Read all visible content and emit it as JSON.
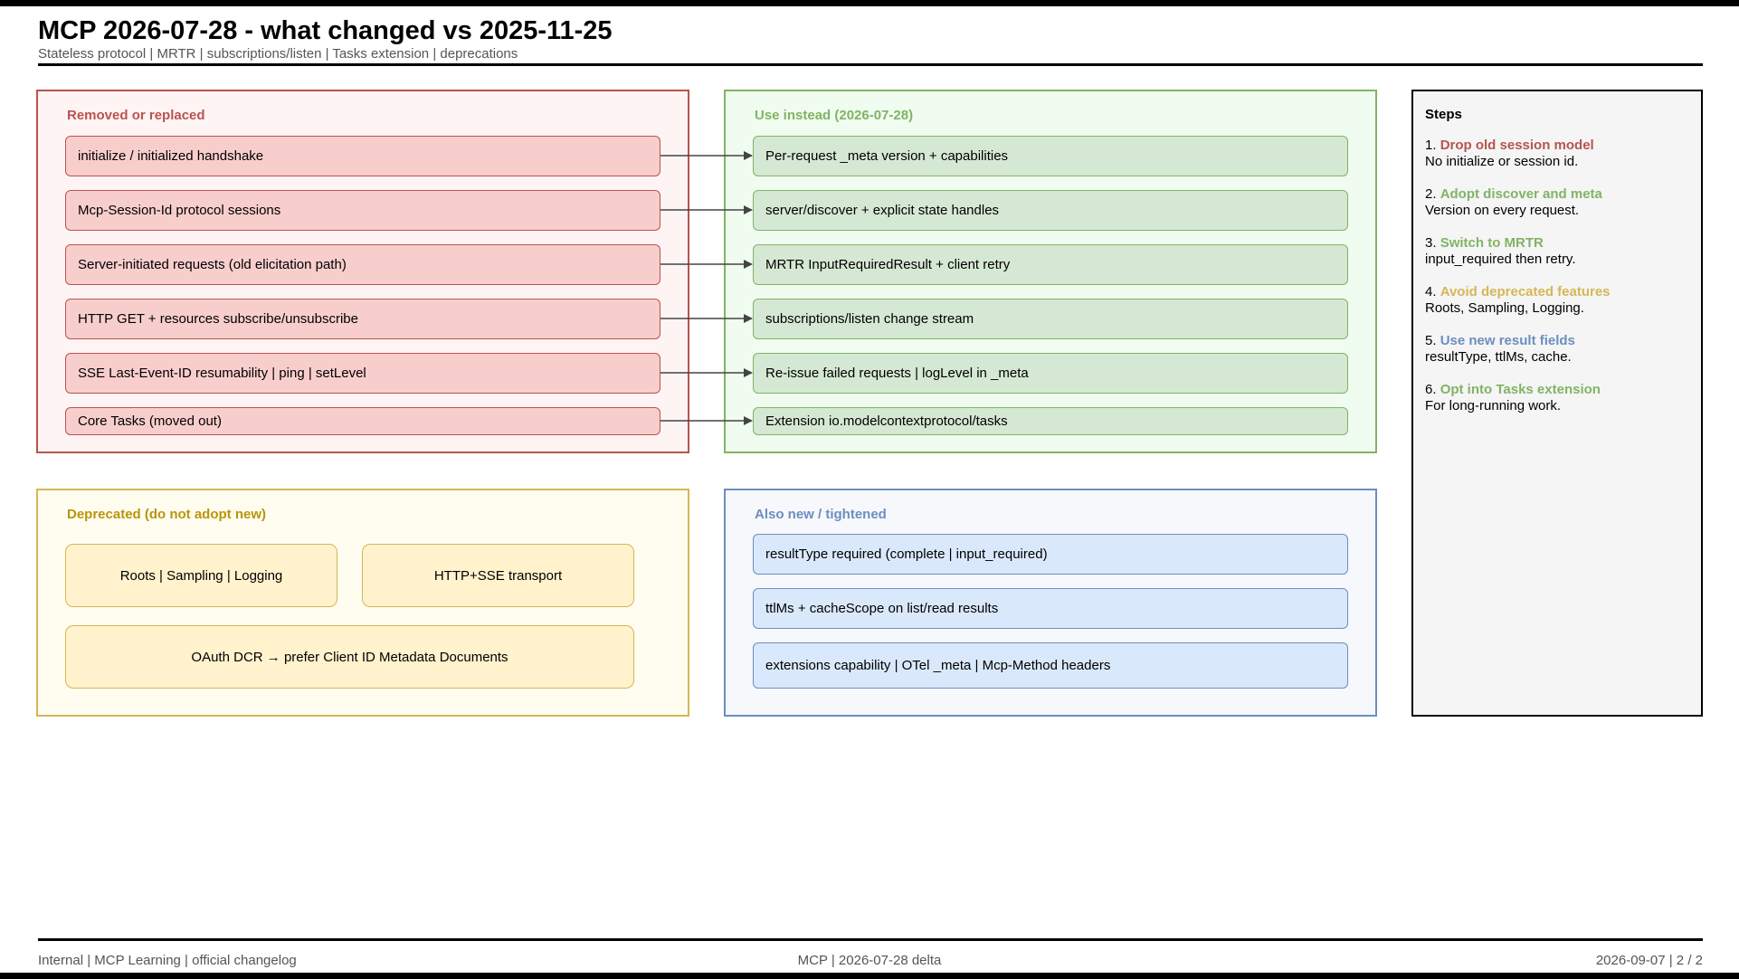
{
  "header": {
    "title": "MCP 2026-07-28 - what changed vs 2025-11-25",
    "subtitle": "Stateless protocol | MRTR | subscriptions/listen | Tasks extension | deprecations"
  },
  "colors": {
    "red": "#b85450",
    "green": "#82b366",
    "yellow": "#d6b656",
    "blue": "#6c8ebf",
    "arrow": "#444444"
  },
  "removed": {
    "label": "Removed or replaced",
    "items": [
      "initialize / initialized handshake",
      "Mcp-Session-Id protocol sessions",
      "Server-initiated requests (old elicitation path)",
      "HTTP GET + resources subscribe/unsubscribe",
      "SSE Last-Event-ID resumability | ping | setLevel",
      "Core Tasks (moved out)"
    ]
  },
  "use_instead": {
    "label": "Use instead (2026-07-28)",
    "items": [
      "Per-request _meta version + capabilities",
      "server/discover + explicit state handles",
      "MRTR InputRequiredResult + client retry",
      "subscriptions/listen change stream",
      "Re-issue failed requests | logLevel in _meta",
      "Extension io.modelcontextprotocol/tasks"
    ]
  },
  "deprecated": {
    "label": "Deprecated (do not adopt new)",
    "items": [
      "Roots | Sampling | Logging",
      "HTTP+SSE transport",
      "OAuth DCR → prefer Client ID Metadata Documents"
    ]
  },
  "also_new": {
    "label": "Also new / tightened",
    "items": [
      "resultType required (complete | input_required)",
      "ttlMs + cacheScope on list/read results",
      "extensions capability | OTel _meta | Mcp-Method headers"
    ]
  },
  "steps": {
    "title": "Steps",
    "items": [
      {
        "num": "1.",
        "head": "Drop old session model",
        "body": "No initialize or session id.",
        "color": "#b85450"
      },
      {
        "num": "2.",
        "head": "Adopt discover and meta",
        "body": "Version on every request.",
        "color": "#82b366"
      },
      {
        "num": "3.",
        "head": "Switch to MRTR",
        "body": "input_required then retry.",
        "color": "#82b366"
      },
      {
        "num": "4.",
        "head": "Avoid deprecated features",
        "body": "Roots, Sampling, Logging.",
        "color": "#d6b656"
      },
      {
        "num": "5.",
        "head": "Use new result fields",
        "body": "resultType, ttlMs, cache.",
        "color": "#6c8ebf"
      },
      {
        "num": "6.",
        "head": "Opt into Tasks extension",
        "body": "For long-running work.",
        "color": "#82b366"
      }
    ]
  },
  "footer": {
    "left": "Internal | MCP Learning | official changelog",
    "center": "MCP | 2026-07-28 delta",
    "right": "2026-09-07 | 2 / 2"
  }
}
